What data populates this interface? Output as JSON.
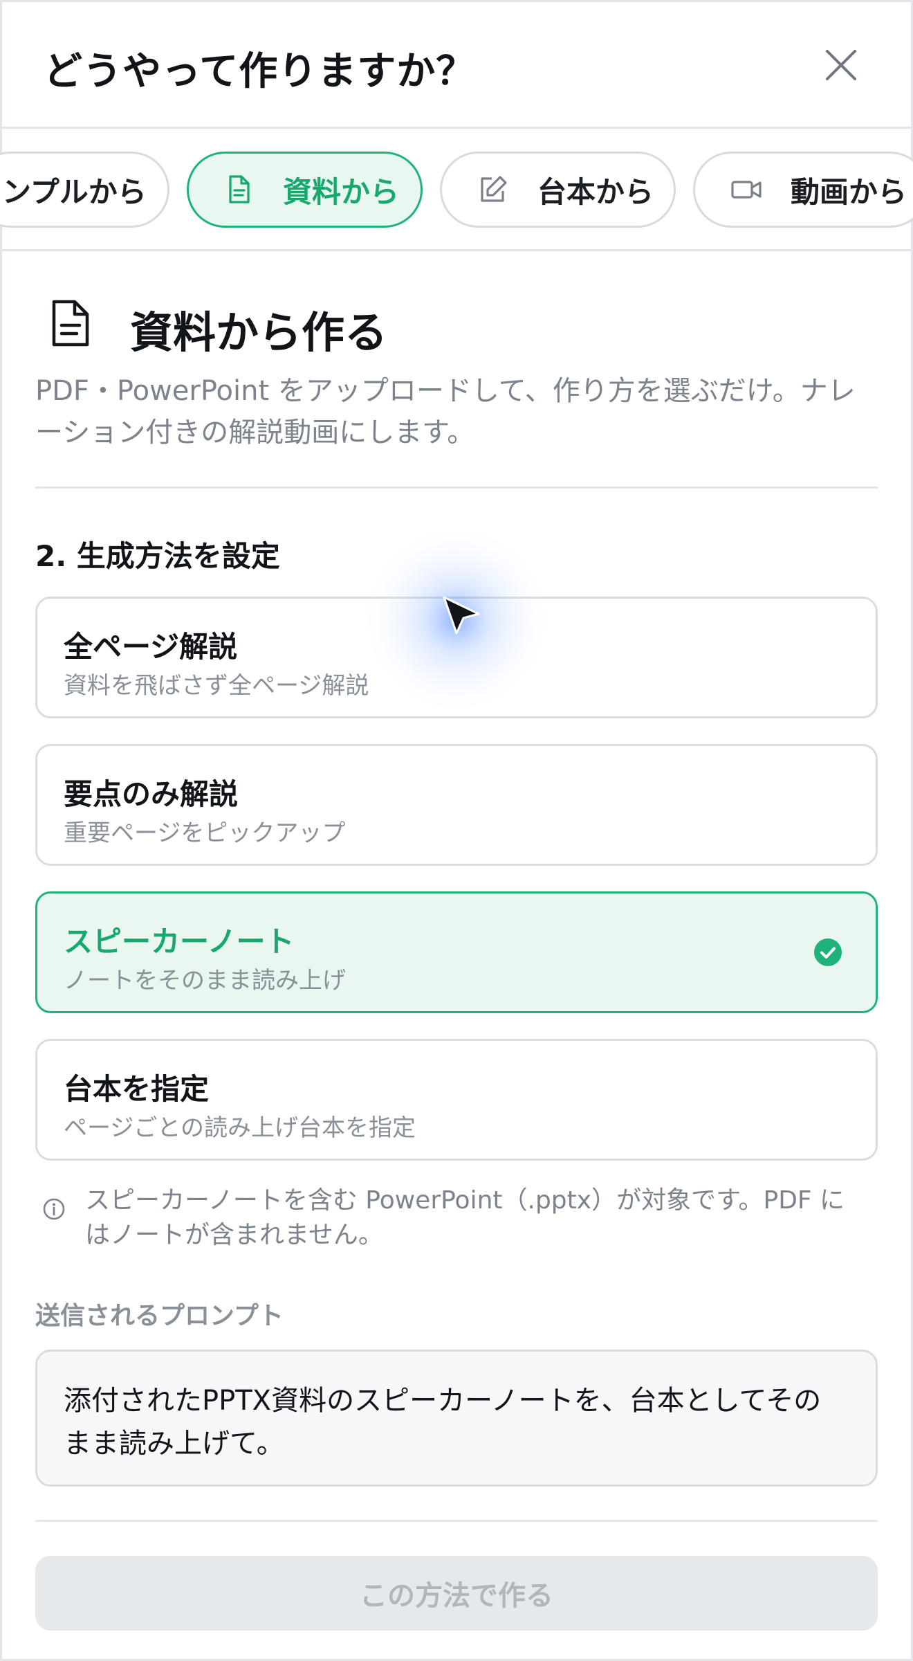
{
  "header": {
    "title": "どうやって作りますか？",
    "close_icon": "close-icon"
  },
  "tabs": [
    {
      "label": "ンプルから",
      "icon": "",
      "active": false
    },
    {
      "label": "資料から",
      "icon": "document-icon",
      "active": true
    },
    {
      "label": "台本から",
      "icon": "edit-icon",
      "active": false
    },
    {
      "label": "動画から",
      "icon": "video-icon",
      "active": false
    }
  ],
  "section": {
    "icon": "document-icon",
    "title": "資料から作る",
    "description": "PDF・PowerPoint をアップロードして、作り方を選ぶだけ。ナレーション付きの解説動画にします。"
  },
  "step": {
    "title": "2. 生成方法を設定"
  },
  "options": [
    {
      "title": "全ページ解説",
      "subtitle": "資料を飛ばさず全ページ解説",
      "selected": false
    },
    {
      "title": "要点のみ解説",
      "subtitle": "重要ページをピックアップ",
      "selected": false
    },
    {
      "title": "スピーカーノート",
      "subtitle": "ノートをそのまま読み上げ",
      "selected": true
    },
    {
      "title": "台本を指定",
      "subtitle": "ページごとの読み上げ台本を指定",
      "selected": false
    }
  ],
  "note": {
    "icon": "info-icon",
    "text": "スピーカーノートを含む PowerPoint（.pptx）が対象です。PDF にはノートが含まれません。"
  },
  "prompt": {
    "label": "送信されるプロンプト",
    "text": "添付されたPPTX資料のスピーカーノートを、台本としてそのまま読み上げて。"
  },
  "submit": {
    "label": "この方法で作る",
    "disabled": true
  },
  "colors": {
    "accent": "#1fb37a",
    "accent_bg": "#eaf7f0",
    "muted_text": "#7c838c",
    "border": "#d9dce1"
  }
}
